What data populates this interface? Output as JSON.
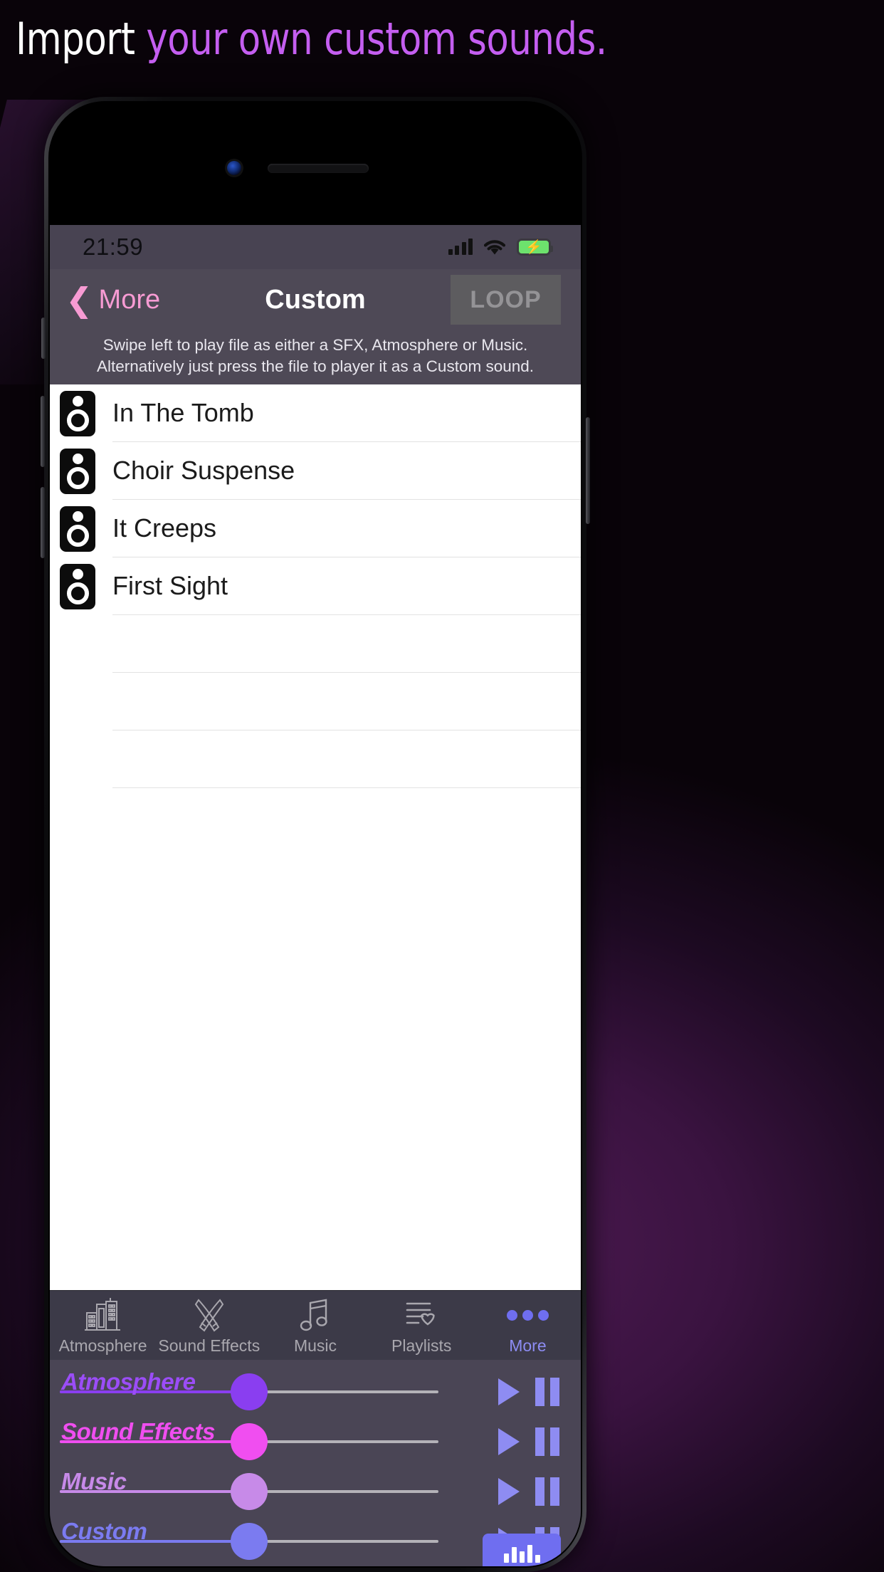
{
  "promo": {
    "headline_white": "Import",
    "headline_accent": "your own custom sounds.",
    "accent_color": "#c45ef0"
  },
  "status_bar": {
    "time": "21:59",
    "signal_icon": "cellular-bars-icon",
    "wifi_icon": "wifi-icon",
    "battery_icon": "battery-charging-icon",
    "battery_color": "#6de26d"
  },
  "nav_bar": {
    "back_label": "More",
    "back_icon": "chevron-left-icon",
    "title": "Custom",
    "loop_label": "LOOP",
    "accent_color": "#f79bd3"
  },
  "hint": {
    "text": "Swipe left to play file as either a SFX, Atmosphere or Music. Alternatively just press the file to player it as a Custom sound."
  },
  "list": {
    "icon": "speaker-icon",
    "items": [
      {
        "title": "In The Tomb"
      },
      {
        "title": "Choir Suspense"
      },
      {
        "title": "It Creeps"
      },
      {
        "title": "First Sight"
      }
    ]
  },
  "tab_bar": {
    "tabs": [
      {
        "label": "Atmosphere",
        "icon": "city-buildings-icon",
        "active": false
      },
      {
        "label": "Sound Effects",
        "icon": "crossed-swords-icon",
        "active": false
      },
      {
        "label": "Music",
        "icon": "music-note-icon",
        "active": false
      },
      {
        "label": "Playlists",
        "icon": "list-heart-icon",
        "active": false
      },
      {
        "label": "More",
        "icon": "ellipsis-icon",
        "active": true
      }
    ],
    "active_color": "#8d8cf3"
  },
  "mixer": {
    "play_icon": "play-icon",
    "pause_icon": "pause-icon",
    "eq_icon": "equalizer-icon",
    "channels": [
      {
        "label": "Atmosphere",
        "color": "#8a3ef0",
        "value": 50
      },
      {
        "label": "Sound Effects",
        "color": "#f04ef0",
        "value": 50
      },
      {
        "label": "Music",
        "color": "#c78ae8",
        "value": 50
      },
      {
        "label": "Custom",
        "color": "#7b7bf0",
        "value": 50
      }
    ]
  }
}
